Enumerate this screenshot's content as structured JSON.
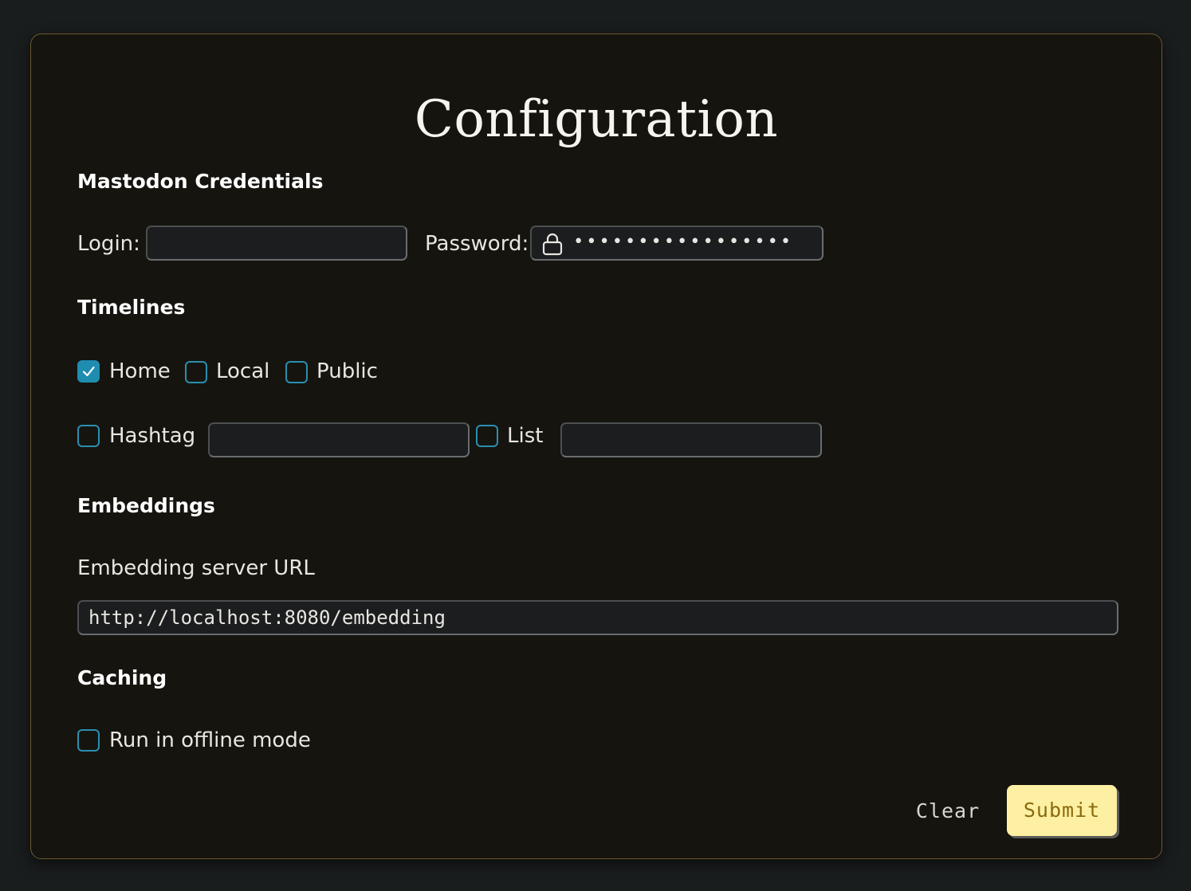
{
  "page": {
    "title": "Configuration"
  },
  "credentials": {
    "heading": "Mastodon Credentials",
    "login_label": "Login:",
    "login_value": "",
    "password_label": "Password:",
    "password_dots": "•••••••••••••••••",
    "lock_icon": "lock-icon"
  },
  "timelines": {
    "heading": "Timelines",
    "home_label": "Home",
    "home_checked": true,
    "local_label": "Local",
    "local_checked": false,
    "public_label": "Public",
    "public_checked": false,
    "hashtag_label": "Hashtag",
    "hashtag_checked": false,
    "hashtag_value": "",
    "list_label": "List",
    "list_checked": false,
    "list_value": ""
  },
  "embeddings": {
    "heading": "Embeddings",
    "url_label": "Embedding server URL",
    "url_value": "http://localhost:8080/embedding"
  },
  "caching": {
    "heading": "Caching",
    "offline_label": "Run in offline mode",
    "offline_checked": false
  },
  "actions": {
    "clear_label": "Clear",
    "submit_label": "Submit"
  },
  "colors": {
    "background": "#1a1d1e",
    "panel": "#16140f",
    "panel_border": "#6b5730",
    "accent": "#1f8db0",
    "submit_bg": "#fdf0a2",
    "submit_text": "#8a6a10"
  }
}
